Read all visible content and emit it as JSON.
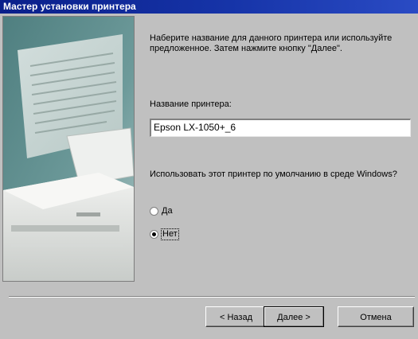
{
  "window": {
    "title": "Мастер установки принтера"
  },
  "wizard": {
    "intro": "Наберите название для данного принтера или используйте предложенное.  Затем нажмите кнопку \"Далее\".",
    "name_label": "Название принтера:",
    "printer_name": "Epson LX-1050+_6",
    "default_question": "Использовать этот принтер по умолчанию в среде Windows?",
    "options": [
      {
        "label": "Да",
        "selected": false
      },
      {
        "label": "Нет",
        "selected": true
      }
    ]
  },
  "buttons": {
    "back": "< Назад",
    "next": "Далее >",
    "cancel": "Отмена"
  },
  "colors": {
    "title_bar": "#0a1f8a",
    "dialog_face": "#c0c0c0"
  },
  "icons": {
    "illustration": "printer-with-document-illustration"
  }
}
